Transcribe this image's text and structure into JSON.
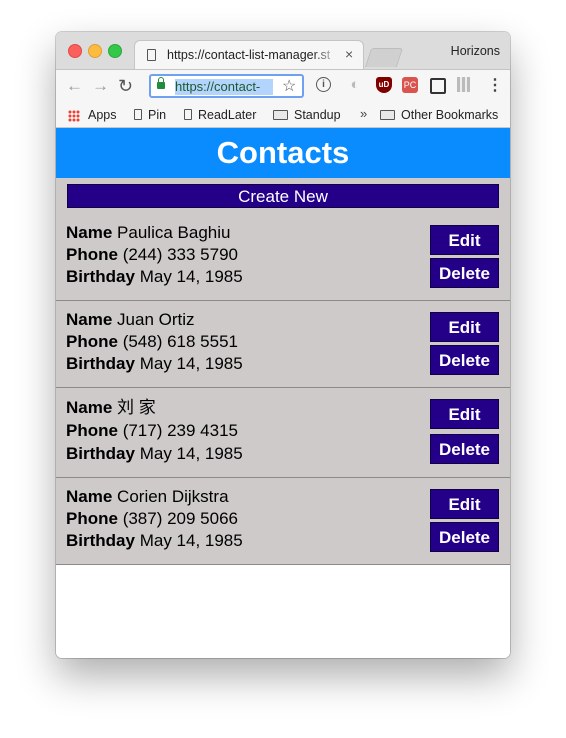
{
  "browser": {
    "tab_title": "https://contact-list-manager.st",
    "tab_close": "×",
    "profile_name": "Horizons",
    "url": "https://contact-",
    "nav": {
      "back": "←",
      "forward": "→",
      "reload": "↻",
      "star": "☆",
      "menu": "⋮"
    },
    "extensions": {
      "info": "i",
      "ublock": "uD",
      "pen": "PC"
    },
    "bookmarks": {
      "apps": "Apps",
      "pin": "Pin",
      "readlater": "ReadLater",
      "standup": "Standup",
      "more": "»",
      "other": "Other Bookmarks"
    }
  },
  "page": {
    "title": "Contacts",
    "create_label": "Create New",
    "labels": {
      "name": "Name",
      "phone": "Phone",
      "birthday": "Birthday"
    },
    "edit_label": "Edit",
    "delete_label": "Delete",
    "contacts": [
      {
        "name": "Paulica Baghiu",
        "phone": "(244) 333 5790",
        "birthday": "May 14, 1985"
      },
      {
        "name": "Juan Ortiz",
        "phone": "(548) 618 5551",
        "birthday": "May 14, 1985"
      },
      {
        "name": "刘 家",
        "phone": "(717) 239 4315",
        "birthday": "May 14, 1985"
      },
      {
        "name": "Corien Dijkstra",
        "phone": "(387) 209 5066",
        "birthday": "May 14, 1985"
      }
    ]
  },
  "colors": {
    "header": "#0a8cff",
    "button": "#240088",
    "content_bg": "#cecaca"
  }
}
